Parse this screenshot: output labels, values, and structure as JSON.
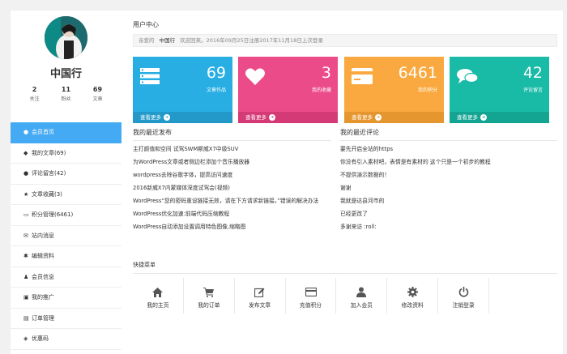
{
  "colors": {
    "accent": "#44aaf3",
    "card_works": "#29aee3",
    "card_fav": "#ec4b89",
    "card_points": "#f9a93f",
    "card_comments": "#19bba7"
  },
  "profile": {
    "name": "中国行",
    "stats": [
      {
        "num": "2",
        "label": "关注"
      },
      {
        "num": "11",
        "label": "粉丝"
      },
      {
        "num": "69",
        "label": "文章"
      }
    ]
  },
  "sidebar": {
    "items": [
      {
        "icon": "users-icon",
        "label": "会员首页"
      },
      {
        "icon": "cube-icon",
        "label": "我的文章(69)"
      },
      {
        "icon": "comments-icon",
        "label": "评论留言(42)"
      },
      {
        "icon": "star-icon",
        "label": "文章收藏(3)"
      },
      {
        "icon": "credit-card-icon",
        "label": "积分管理(6461)"
      },
      {
        "icon": "envelope-icon",
        "label": "站内消息"
      },
      {
        "icon": "gear-icon",
        "label": "编辑资料"
      },
      {
        "icon": "user-icon",
        "label": "会员信息"
      },
      {
        "icon": "share-icon",
        "label": "我的推广"
      },
      {
        "icon": "cart-icon",
        "label": "订单管理"
      },
      {
        "icon": "tag-icon",
        "label": "优惠码"
      }
    ]
  },
  "main": {
    "title": "用户中心",
    "welcome": {
      "prefix": "亲爱的",
      "name": "中国行",
      "suffix": "欢迎回来。2016年09月25日注册2017年11月18日上次登录"
    },
    "cards": [
      {
        "icon": "list-icon",
        "value": "69",
        "label": "文章作品",
        "more": "查看更多"
      },
      {
        "icon": "heart-icon",
        "value": "3",
        "label": "我的收藏",
        "more": "查看更多"
      },
      {
        "icon": "credit-card-icon",
        "value": "6461",
        "label": "我的积分",
        "more": "查看更多"
      },
      {
        "icon": "comments-icon",
        "value": "42",
        "label": "评论留言",
        "more": "查看更多"
      }
    ],
    "recent_posts_title": "我的最近发布",
    "recent_posts": [
      "主打颜值和空间 试驾SWM斯威X7中级SUV",
      "为WordPress文章或者侧边栏添加个音乐播放器",
      "wordpress去除谷歌字体，提高访问速度",
      "2016新威X7内蒙媒体深度试驾会(视频)",
      "WordPress“您的密码重设链接无效，请在下方请求新链接。”错误的解决办法",
      "WordPress优化加速:前端代码压缩教程",
      "WordPress自动添加设置调用特色图像,缩略图"
    ],
    "recent_comments_title": "我的最近评论",
    "recent_comments": [
      "要先开启全站的https",
      "你没有引入素材吧，表情是有素材的 这个只是一个初步的教程",
      "不提供演示数据的！",
      "谢谢",
      "我就是达县河市的",
      "已经更改了",
      "多谢来访 :roll:"
    ],
    "quick_title": "快捷菜单",
    "quick_menu": [
      {
        "icon": "home-icon",
        "label": "我的主页"
      },
      {
        "icon": "cart-icon",
        "label": "我的订单"
      },
      {
        "icon": "edit-icon",
        "label": "发布文章"
      },
      {
        "icon": "credit-card-icon",
        "label": "充值积分"
      },
      {
        "icon": "user-plus-icon",
        "label": "加入会员"
      },
      {
        "icon": "gear-icon",
        "label": "修改资料"
      },
      {
        "icon": "power-icon",
        "label": "注销登录"
      }
    ]
  }
}
